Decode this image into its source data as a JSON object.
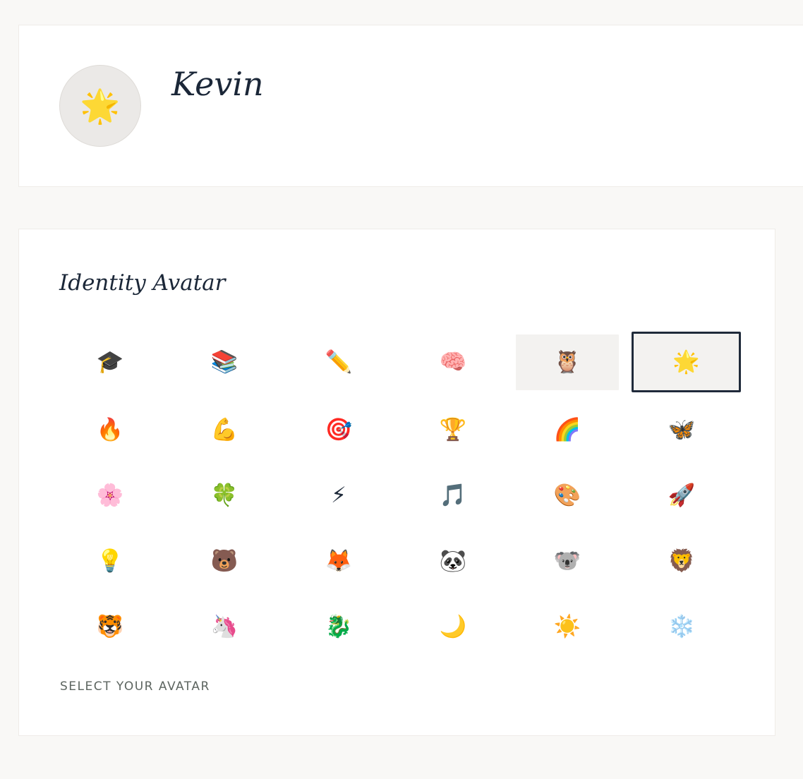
{
  "profile": {
    "name": "Kevin",
    "current_avatar": "🌟"
  },
  "avatar_section": {
    "title": "Identity Avatar",
    "hint": "SELECT YOUR AVATAR",
    "hovered_index": 4,
    "selected_index": 5,
    "options": [
      {
        "emoji": "🎓",
        "icon": "graduation-cap-icon"
      },
      {
        "emoji": "📚",
        "icon": "books-icon"
      },
      {
        "emoji": "✏️",
        "icon": "pencil-icon"
      },
      {
        "emoji": "🧠",
        "icon": "brain-icon"
      },
      {
        "emoji": "🦉",
        "icon": "owl-icon"
      },
      {
        "emoji": "🌟",
        "icon": "glowing-star-icon"
      },
      {
        "emoji": "🔥",
        "icon": "fire-icon"
      },
      {
        "emoji": "💪",
        "icon": "flexed-biceps-icon"
      },
      {
        "emoji": "🎯",
        "icon": "target-icon"
      },
      {
        "emoji": "🏆",
        "icon": "trophy-icon"
      },
      {
        "emoji": "🌈",
        "icon": "rainbow-icon"
      },
      {
        "emoji": "🦋",
        "icon": "butterfly-icon"
      },
      {
        "emoji": "🌸",
        "icon": "cherry-blossom-icon"
      },
      {
        "emoji": "🍀",
        "icon": "four-leaf-clover-icon"
      },
      {
        "emoji": "⚡",
        "icon": "lightning-icon"
      },
      {
        "emoji": "🎵",
        "icon": "music-note-icon"
      },
      {
        "emoji": "🎨",
        "icon": "palette-icon"
      },
      {
        "emoji": "🚀",
        "icon": "rocket-icon"
      },
      {
        "emoji": "💡",
        "icon": "light-bulb-icon"
      },
      {
        "emoji": "🐻",
        "icon": "bear-icon"
      },
      {
        "emoji": "🦊",
        "icon": "fox-icon"
      },
      {
        "emoji": "🐼",
        "icon": "panda-icon"
      },
      {
        "emoji": "🐨",
        "icon": "koala-icon"
      },
      {
        "emoji": "🦁",
        "icon": "lion-icon"
      },
      {
        "emoji": "🐯",
        "icon": "tiger-icon"
      },
      {
        "emoji": "🦄",
        "icon": "unicorn-icon"
      },
      {
        "emoji": "🐉",
        "icon": "dragon-icon"
      },
      {
        "emoji": "🌙",
        "icon": "crescent-moon-icon"
      },
      {
        "emoji": "☀️",
        "icon": "sun-icon"
      },
      {
        "emoji": "❄️",
        "icon": "snowflake-icon"
      }
    ]
  }
}
